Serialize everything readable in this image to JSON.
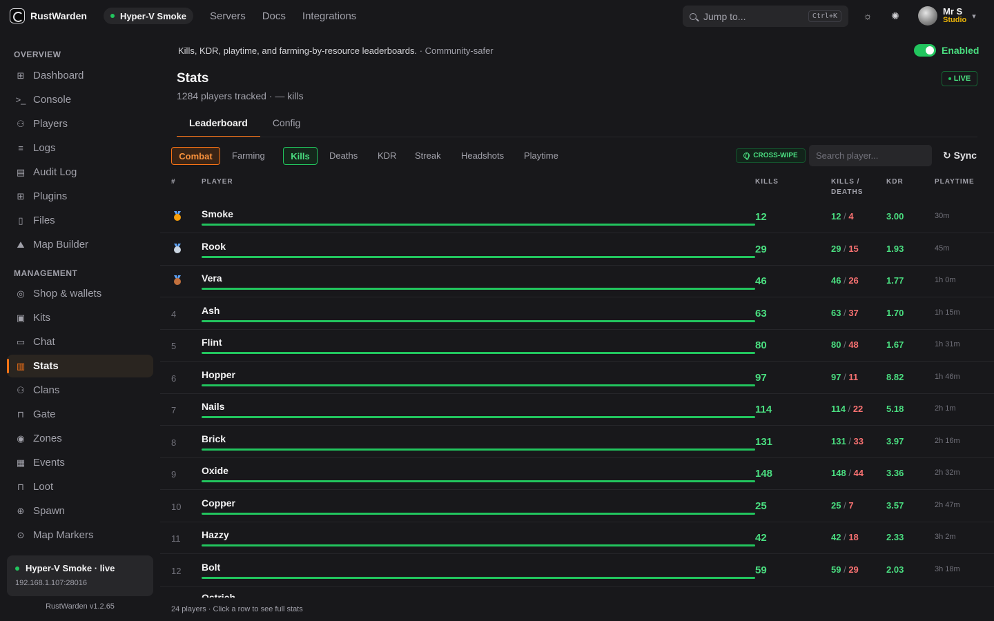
{
  "topbar": {
    "brand": "RustWarden",
    "server_pill": "Hyper-V Smoke",
    "nav": [
      "Servers",
      "Docs",
      "Integrations"
    ],
    "jump_placeholder": "Jump to...",
    "jump_shortcut": "Ctrl+K",
    "user_name": "Mr S",
    "user_role": "Studio"
  },
  "sidebar": {
    "overview_label": "OVERVIEW",
    "overview_items": [
      {
        "label": "Dashboard",
        "icon": "grid-icon"
      },
      {
        "label": "Console",
        "icon": "terminal-icon"
      },
      {
        "label": "Players",
        "icon": "users-icon"
      },
      {
        "label": "Logs",
        "icon": "list-icon"
      },
      {
        "label": "Audit Log",
        "icon": "clipboard-icon"
      },
      {
        "label": "Plugins",
        "icon": "puzzle-icon"
      },
      {
        "label": "Files",
        "icon": "file-icon"
      },
      {
        "label": "Map Builder",
        "icon": "map-icon"
      }
    ],
    "management_label": "MANAGEMENT",
    "management_items": [
      {
        "label": "Shop & wallets",
        "icon": "coin-icon"
      },
      {
        "label": "Kits",
        "icon": "bag-icon"
      },
      {
        "label": "Chat",
        "icon": "chat-icon"
      },
      {
        "label": "Stats",
        "icon": "bar-chart-icon",
        "active": true
      },
      {
        "label": "Clans",
        "icon": "group-icon"
      },
      {
        "label": "Gate",
        "icon": "lock-icon"
      },
      {
        "label": "Zones",
        "icon": "target-icon"
      },
      {
        "label": "Events",
        "icon": "calendar-icon"
      },
      {
        "label": "Loot",
        "icon": "lock-icon"
      },
      {
        "label": "Spawn",
        "icon": "plus-circle-icon"
      },
      {
        "label": "Map Markers",
        "icon": "pin-icon"
      }
    ],
    "server_card": {
      "title": "Hyper-V Smoke · live",
      "ip": "192.168.1.107:28016"
    },
    "version": "RustWarden v1.2.65"
  },
  "main": {
    "description": "Kills, KDR, playtime, and farming-by-resource leaderboards.",
    "description_suffix": "· Community-safer",
    "enabled_label": "Enabled",
    "live_label": "LIVE",
    "title": "Stats",
    "subtitle": "1284 players tracked · — kills",
    "tabs": [
      "Leaderboard",
      "Config"
    ],
    "categories": [
      "Combat",
      "Farming"
    ],
    "metrics": [
      "Kills",
      "Deaths",
      "KDR",
      "Streak",
      "Headshots",
      "Playtime"
    ],
    "crosswipe_label": "CROSS-WIPE",
    "search_placeholder": "Search player...",
    "sync_label": "Sync",
    "columns": {
      "rank": "#",
      "player": "PLAYER",
      "kills": "KILLS",
      "kd_line1": "KILLS /",
      "kd_line2": "DEATHS",
      "kdr": "KDR",
      "playtime": "PLAYTIME"
    },
    "rows": [
      {
        "rank": "1",
        "medal": "gold",
        "name": "Smoke",
        "kills": "12",
        "k": "12",
        "d": "4",
        "kdr": "3.00",
        "playtime": "30m"
      },
      {
        "rank": "2",
        "medal": "silver",
        "name": "Rook",
        "kills": "29",
        "k": "29",
        "d": "15",
        "kdr": "1.93",
        "playtime": "45m"
      },
      {
        "rank": "3",
        "medal": "bronze",
        "name": "Vera",
        "kills": "46",
        "k": "46",
        "d": "26",
        "kdr": "1.77",
        "playtime": "1h 0m"
      },
      {
        "rank": "4",
        "name": "Ash",
        "kills": "63",
        "k": "63",
        "d": "37",
        "kdr": "1.70",
        "playtime": "1h 15m"
      },
      {
        "rank": "5",
        "name": "Flint",
        "kills": "80",
        "k": "80",
        "d": "48",
        "kdr": "1.67",
        "playtime": "1h 31m"
      },
      {
        "rank": "6",
        "name": "Hopper",
        "kills": "97",
        "k": "97",
        "d": "11",
        "kdr": "8.82",
        "playtime": "1h 46m"
      },
      {
        "rank": "7",
        "name": "Nails",
        "kills": "114",
        "k": "114",
        "d": "22",
        "kdr": "5.18",
        "playtime": "2h 1m"
      },
      {
        "rank": "8",
        "name": "Brick",
        "kills": "131",
        "k": "131",
        "d": "33",
        "kdr": "3.97",
        "playtime": "2h 16m"
      },
      {
        "rank": "9",
        "name": "Oxide",
        "kills": "148",
        "k": "148",
        "d": "44",
        "kdr": "3.36",
        "playtime": "2h 32m"
      },
      {
        "rank": "10",
        "name": "Copper",
        "kills": "25",
        "k": "25",
        "d": "7",
        "kdr": "3.57",
        "playtime": "2h 47m"
      },
      {
        "rank": "11",
        "name": "Hazzy",
        "kills": "42",
        "k": "42",
        "d": "18",
        "kdr": "2.33",
        "playtime": "3h 2m"
      },
      {
        "rank": "12",
        "name": "Bolt",
        "kills": "59",
        "k": "59",
        "d": "29",
        "kdr": "2.03",
        "playtime": "3h 18m"
      }
    ],
    "footer": "24 players · Click a row to see full stats"
  },
  "colors": {
    "accent": "#f97316",
    "positive": "#22c55e",
    "negative": "#f87171",
    "warning": "#eab308"
  }
}
